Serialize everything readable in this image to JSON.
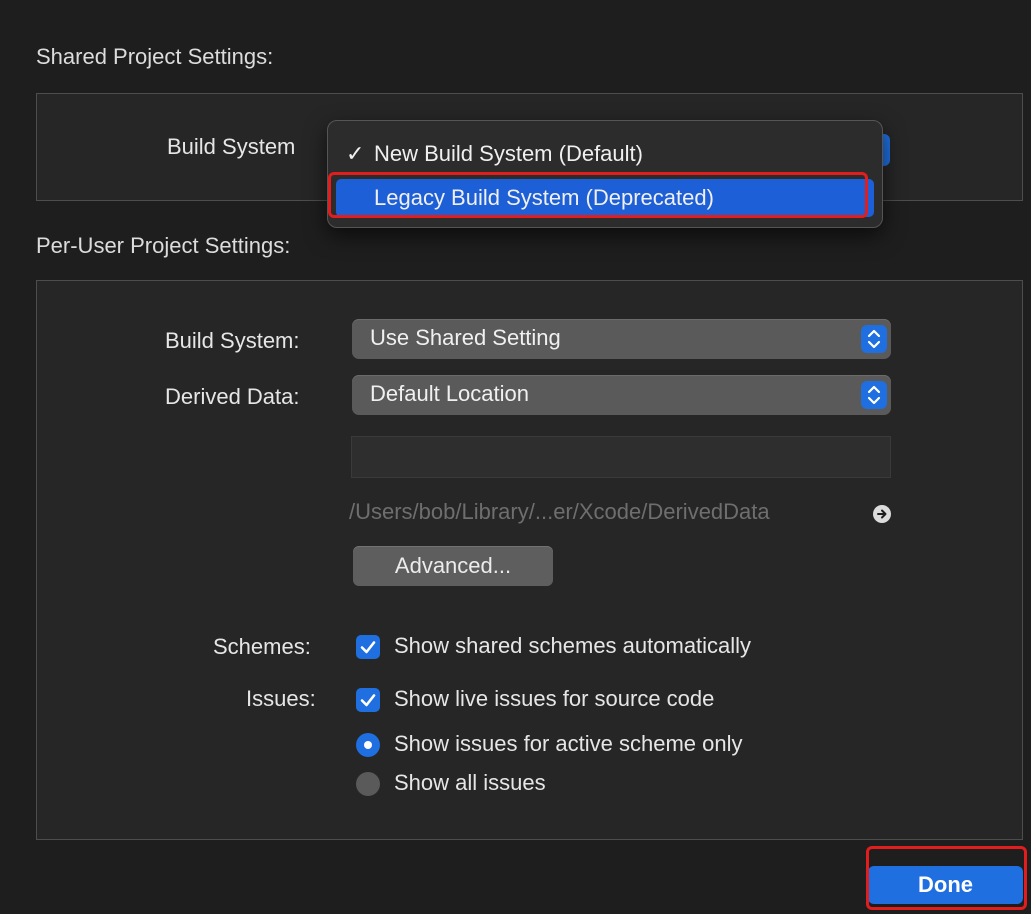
{
  "shared": {
    "title": "Shared Project Settings:",
    "build_system_label": "Build System",
    "menu": {
      "items": [
        {
          "label": "New Build System (Default)",
          "checked": true
        },
        {
          "label": "Legacy Build System (Deprecated)",
          "checked": false,
          "highlighted": true
        }
      ],
      "check_glyph": "✓"
    }
  },
  "per_user": {
    "title": "Per-User Project Settings:",
    "build_system_label": "Build System:",
    "build_system_value": "Use Shared Setting",
    "derived_data_label": "Derived Data:",
    "derived_data_value": "Default Location",
    "derived_data_path": "/Users/bob/Library/...er/Xcode/DerivedData",
    "advanced_button": "Advanced...",
    "schemes_label": "Schemes:",
    "schemes_option": "Show shared schemes automatically",
    "issues_label": "Issues:",
    "issues_live": "Show live issues for source code",
    "issues_active_scheme": "Show issues for active scheme only",
    "issues_all": "Show all issues"
  },
  "done_button": "Done",
  "colors": {
    "accent": "#1f6fe0",
    "highlight_frame": "#e11d1d",
    "background": "#1e1e1e"
  },
  "icons": {
    "stepper": "chevron-up-down-icon",
    "checkbox": "checkmark-icon",
    "reveal": "arrow-right-circle-icon"
  }
}
